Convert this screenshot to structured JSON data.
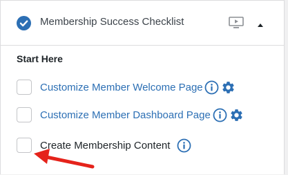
{
  "header": {
    "title": "Membership Success Checklist",
    "status_icon": "check-circle-icon",
    "video_icon": "screen-play-icon",
    "toggle_icon": "triangle-up-icon"
  },
  "section": {
    "heading": "Start Here",
    "items": [
      {
        "label": "Customize Member Welcome Page",
        "checked": false,
        "is_link": true,
        "icons": [
          "info-icon",
          "gear-icon"
        ]
      },
      {
        "label": "Customize Member Dashboard Page",
        "checked": false,
        "is_link": true,
        "icons": [
          "info-icon",
          "gear-icon"
        ]
      },
      {
        "label": "Create Membership Content",
        "checked": false,
        "is_link": false,
        "icons": [
          "info-icon"
        ]
      }
    ]
  },
  "annotation": {
    "icon": "red-arrow-icon",
    "color": "#e5231b"
  },
  "colors": {
    "accent": "#2c6fb4",
    "text": "#1d2327",
    "border": "#dcdcde"
  }
}
